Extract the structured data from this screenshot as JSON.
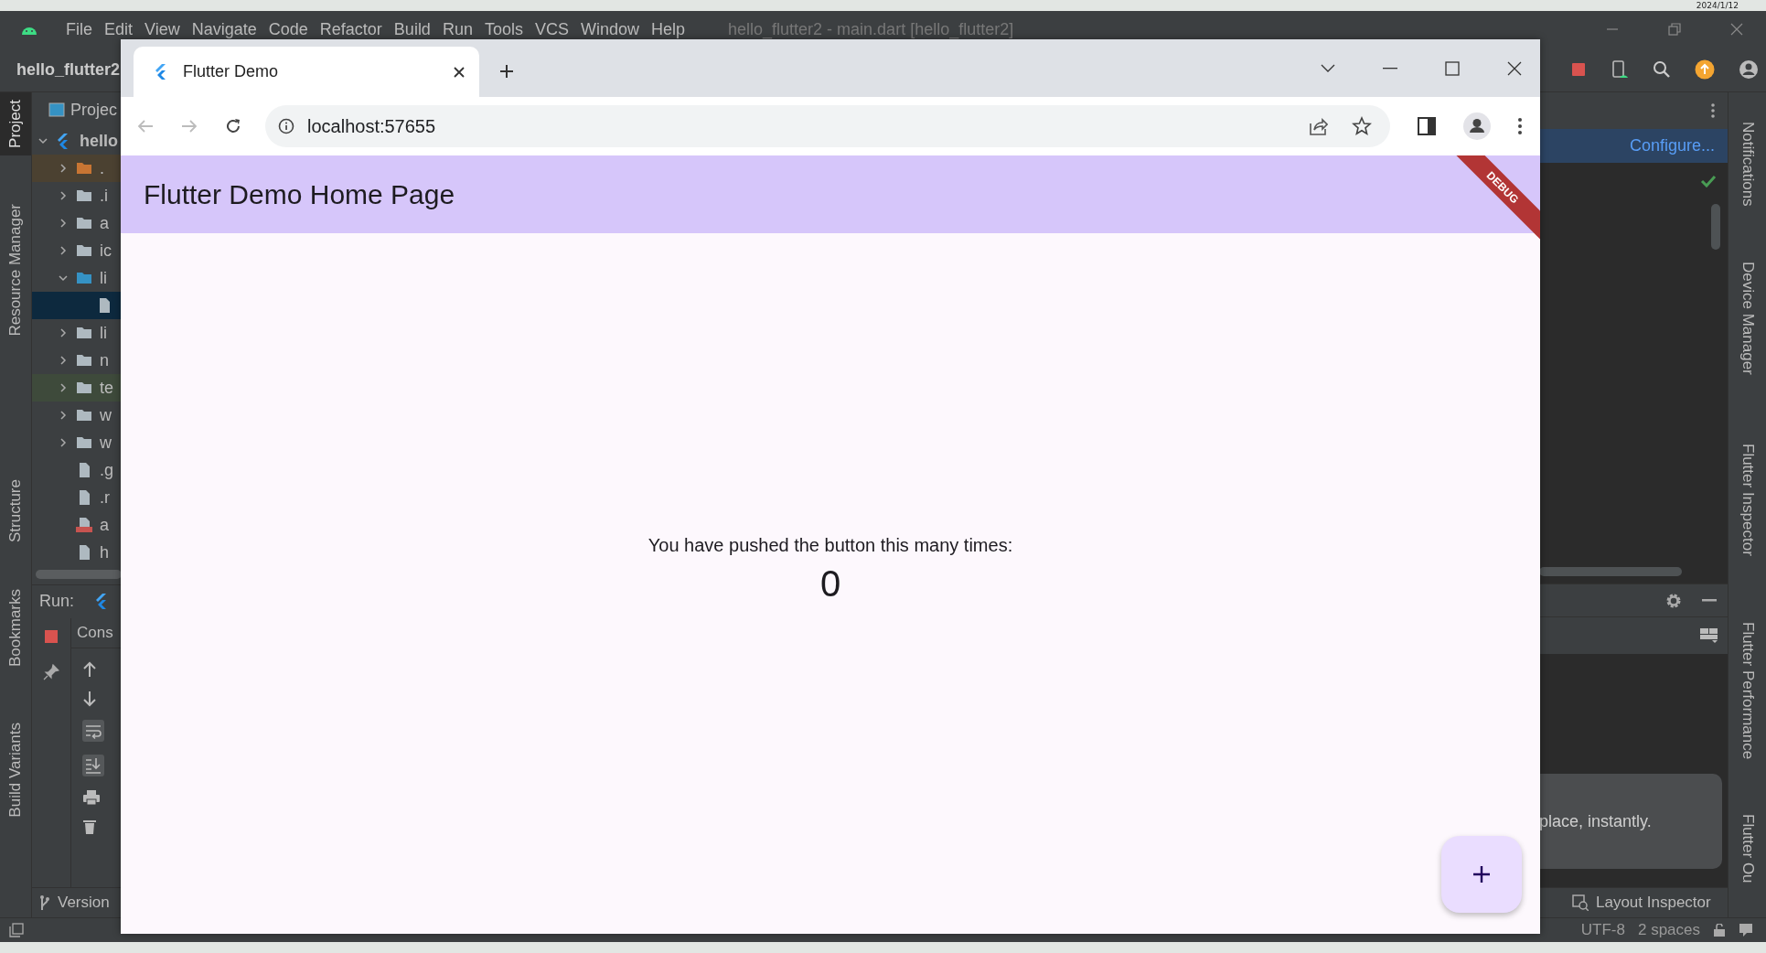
{
  "desktop": {
    "date": "2024/1/12"
  },
  "ide": {
    "menu": [
      "File",
      "Edit",
      "View",
      "Navigate",
      "Code",
      "Refactor",
      "Build",
      "Run",
      "Tools",
      "VCS",
      "Window",
      "Help"
    ],
    "title": "hello_flutter2 - main.dart [hello_flutter2]",
    "project_name": "hello_flutter2",
    "left_tool_strip": [
      {
        "label": "Project",
        "selected": true
      },
      {
        "label": "Resource Manager",
        "selected": false
      },
      {
        "label": "Structure",
        "selected": false
      },
      {
        "label": "Bookmarks",
        "selected": false
      },
      {
        "label": "Build Variants",
        "selected": false
      }
    ],
    "project_panel": {
      "title": "Projec",
      "tree": [
        {
          "label": "hello",
          "kind": "project",
          "expanded": true,
          "selected": false,
          "children": [
            {
              "label": ".",
              "kind": "excluded",
              "expanded": false,
              "selected": false,
              "color": "#4b4131"
            },
            {
              "label": ".i",
              "kind": "folder",
              "expanded": false,
              "selected": false
            },
            {
              "label": "a",
              "kind": "folder",
              "expanded": false,
              "selected": false
            },
            {
              "label": "ic",
              "kind": "folder",
              "expanded": false,
              "selected": false
            },
            {
              "label": "li",
              "kind": "source",
              "expanded": true,
              "selected": false,
              "children": [
                {
                  "kind": "file",
                  "selected": true
                }
              ]
            },
            {
              "label": "li",
              "kind": "folder",
              "expanded": false,
              "selected": false
            },
            {
              "label": "n",
              "kind": "folder",
              "expanded": false,
              "selected": false
            },
            {
              "label": "te",
              "kind": "folder",
              "expanded": false,
              "selected": false,
              "color": "#3e4a3b"
            },
            {
              "label": "w",
              "kind": "folder",
              "expanded": false,
              "selected": false
            },
            {
              "label": "w",
              "kind": "folder",
              "expanded": false,
              "selected": false
            },
            {
              "label": ".g",
              "kind": "file",
              "selected": false
            },
            {
              "label": ".r",
              "kind": "file",
              "selected": false
            },
            {
              "label": "a",
              "kind": "yml",
              "selected": false
            },
            {
              "label": "h",
              "kind": "file",
              "selected": false
            }
          ]
        }
      ]
    },
    "run_panel": {
      "label": "Run:",
      "tab": "Cons"
    },
    "version_control": "Version",
    "right_panel": {
      "banner_action": "Configure...",
      "popup_text": "place, instantly.",
      "layout_inspector": "Layout Inspector"
    },
    "right_tool_strip": [
      "Notifications",
      "Device Manager",
      "Flutter Inspector",
      "Flutter Performance",
      "Flutter Ou"
    ],
    "status_bar": [
      "UTF-8",
      "2 spaces"
    ]
  },
  "browser": {
    "tab": {
      "title": "Flutter Demo",
      "selected": true
    },
    "nav": {
      "back_disabled": true,
      "forward_disabled": true
    },
    "url": "localhost:57655",
    "app": {
      "title": "Flutter Demo Home Page",
      "banner": "DEBUG",
      "message": "You have pushed the button this many times:",
      "counter": "0"
    }
  }
}
